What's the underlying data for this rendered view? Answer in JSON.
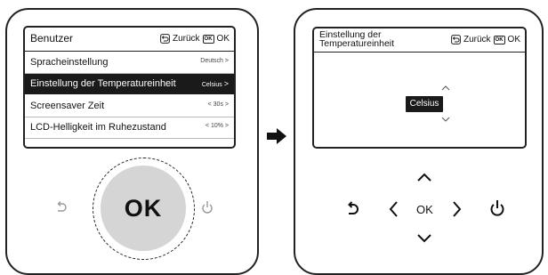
{
  "left": {
    "header": {
      "title": "Benutzer",
      "back_label": "Zurück",
      "ok_key": "OK",
      "ok_label": "OK"
    },
    "menu": [
      {
        "label": "Spracheinstellung",
        "value": "Deutsch",
        "selected": false
      },
      {
        "label": "Einstellung der Temperatureinheit",
        "value": "Celsius",
        "selected": true
      },
      {
        "label": "Screensaver Zeit",
        "value": "30s",
        "selected": false
      },
      {
        "label": "LCD-Helligkeit im Ruhezustand",
        "value": "10%",
        "selected": false
      }
    ],
    "ok_button": "OK"
  },
  "right": {
    "header": {
      "title_line1": "Einstellung der",
      "title_line2": "Temperatureinheit",
      "back_label": "Zurück",
      "ok_key": "OK",
      "ok_label": "OK"
    },
    "current_value": "Celsius",
    "ok_button": "OK"
  },
  "icons": [
    "back-icon",
    "power-icon",
    "arrow-right-icon",
    "chevron-up-icon",
    "chevron-down-icon",
    "chevron-left-icon",
    "chevron-right-icon"
  ]
}
